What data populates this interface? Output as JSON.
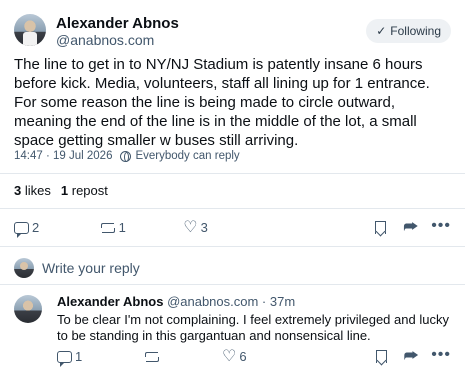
{
  "post": {
    "author_name": "Alexander Abnos",
    "author_handle": "@anabnos.com",
    "follow_label": "Following",
    "text": "The line to get in to NY/NJ Stadium is patently insane 6 hours before kick. Media, volunteers, staff all lining up for 1 entrance. For some reason the line is being made to circle outward, meaning the end of the line is in the middle of the lot, a small space getting smaller w buses still arriving.",
    "timestamp": "14:47 · 19 Jul 2026",
    "visibility": "Everybody can reply",
    "likes_count": "3",
    "likes_label": "likes",
    "reposts_count": "1",
    "reposts_label": "repost",
    "reply_count": "2",
    "repost_count": "1",
    "like_count": "3"
  },
  "reply_box": {
    "placeholder": "Write your reply"
  },
  "reply": {
    "author_name": "Alexander Abnos",
    "handle_time": "@anabnos.com · 37m",
    "text": "To be clear I'm not complaining. I feel extremely privileged and lucky to be standing in this gargantuan and nonsensical line.",
    "reply_count": "1",
    "like_count": "6"
  },
  "icons": {
    "reply": "reply-icon",
    "repost": "repost-icon",
    "like": "heart-icon",
    "bookmark": "bookmark-icon",
    "share": "share-icon",
    "more": "more-icon",
    "globe": "globe-icon",
    "check": "check-icon"
  },
  "colors": {
    "secondary_text": "#42576c",
    "divider": "#e3e8ed",
    "follow_bg": "#eef1f4"
  }
}
